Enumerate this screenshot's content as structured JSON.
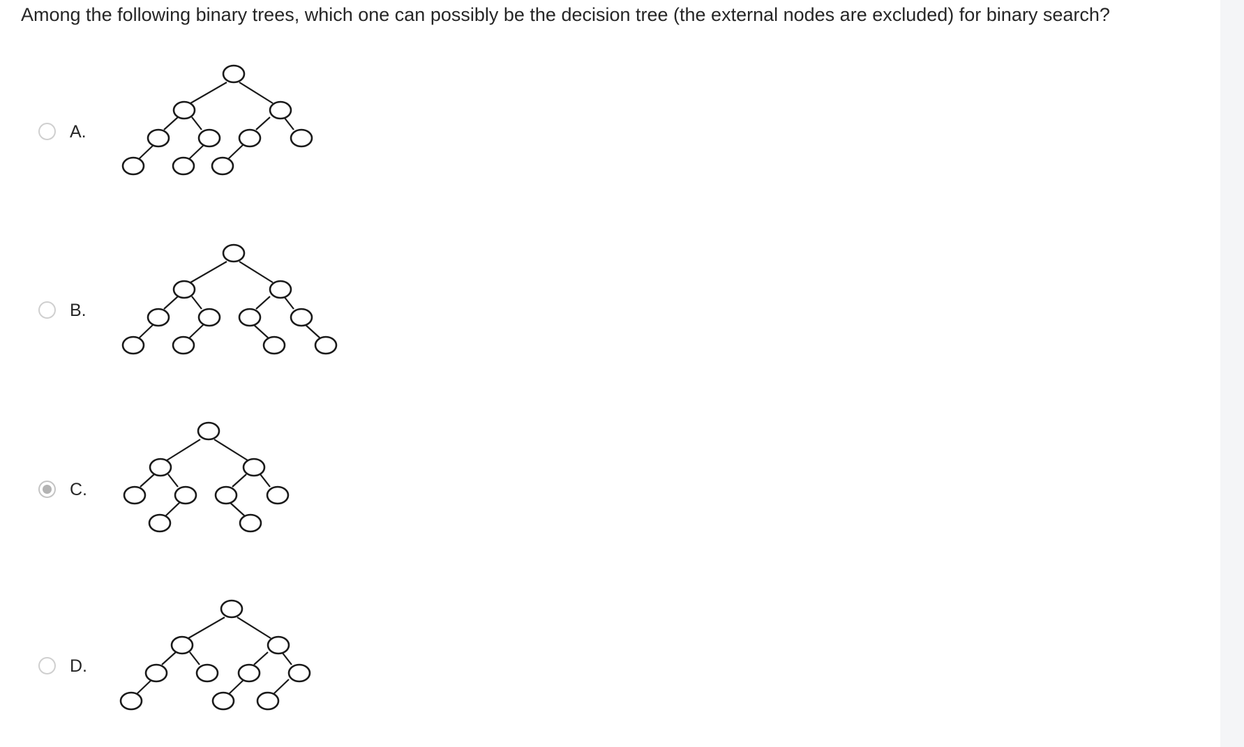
{
  "question": {
    "text": "Among the following binary trees, which one can possibly be the decision tree (the external nodes are excluded) for binary search?"
  },
  "options": [
    {
      "label": "A.",
      "selected": false,
      "image": "binary-tree-diagram"
    },
    {
      "label": "B.",
      "selected": false,
      "image": "binary-tree-diagram"
    },
    {
      "label": "C.",
      "selected": true,
      "image": "binary-tree-diagram"
    },
    {
      "label": "D.",
      "selected": false,
      "image": "binary-tree-diagram"
    }
  ],
  "icons": {
    "radio_unchecked": "radio-unchecked-icon",
    "radio_checked": "radio-checked-icon"
  },
  "colors": {
    "text": "#262626",
    "radio_border": "#cfcfcf",
    "radio_fill_selected": "#b3b3b3",
    "gutter": "#f4f5f7"
  }
}
